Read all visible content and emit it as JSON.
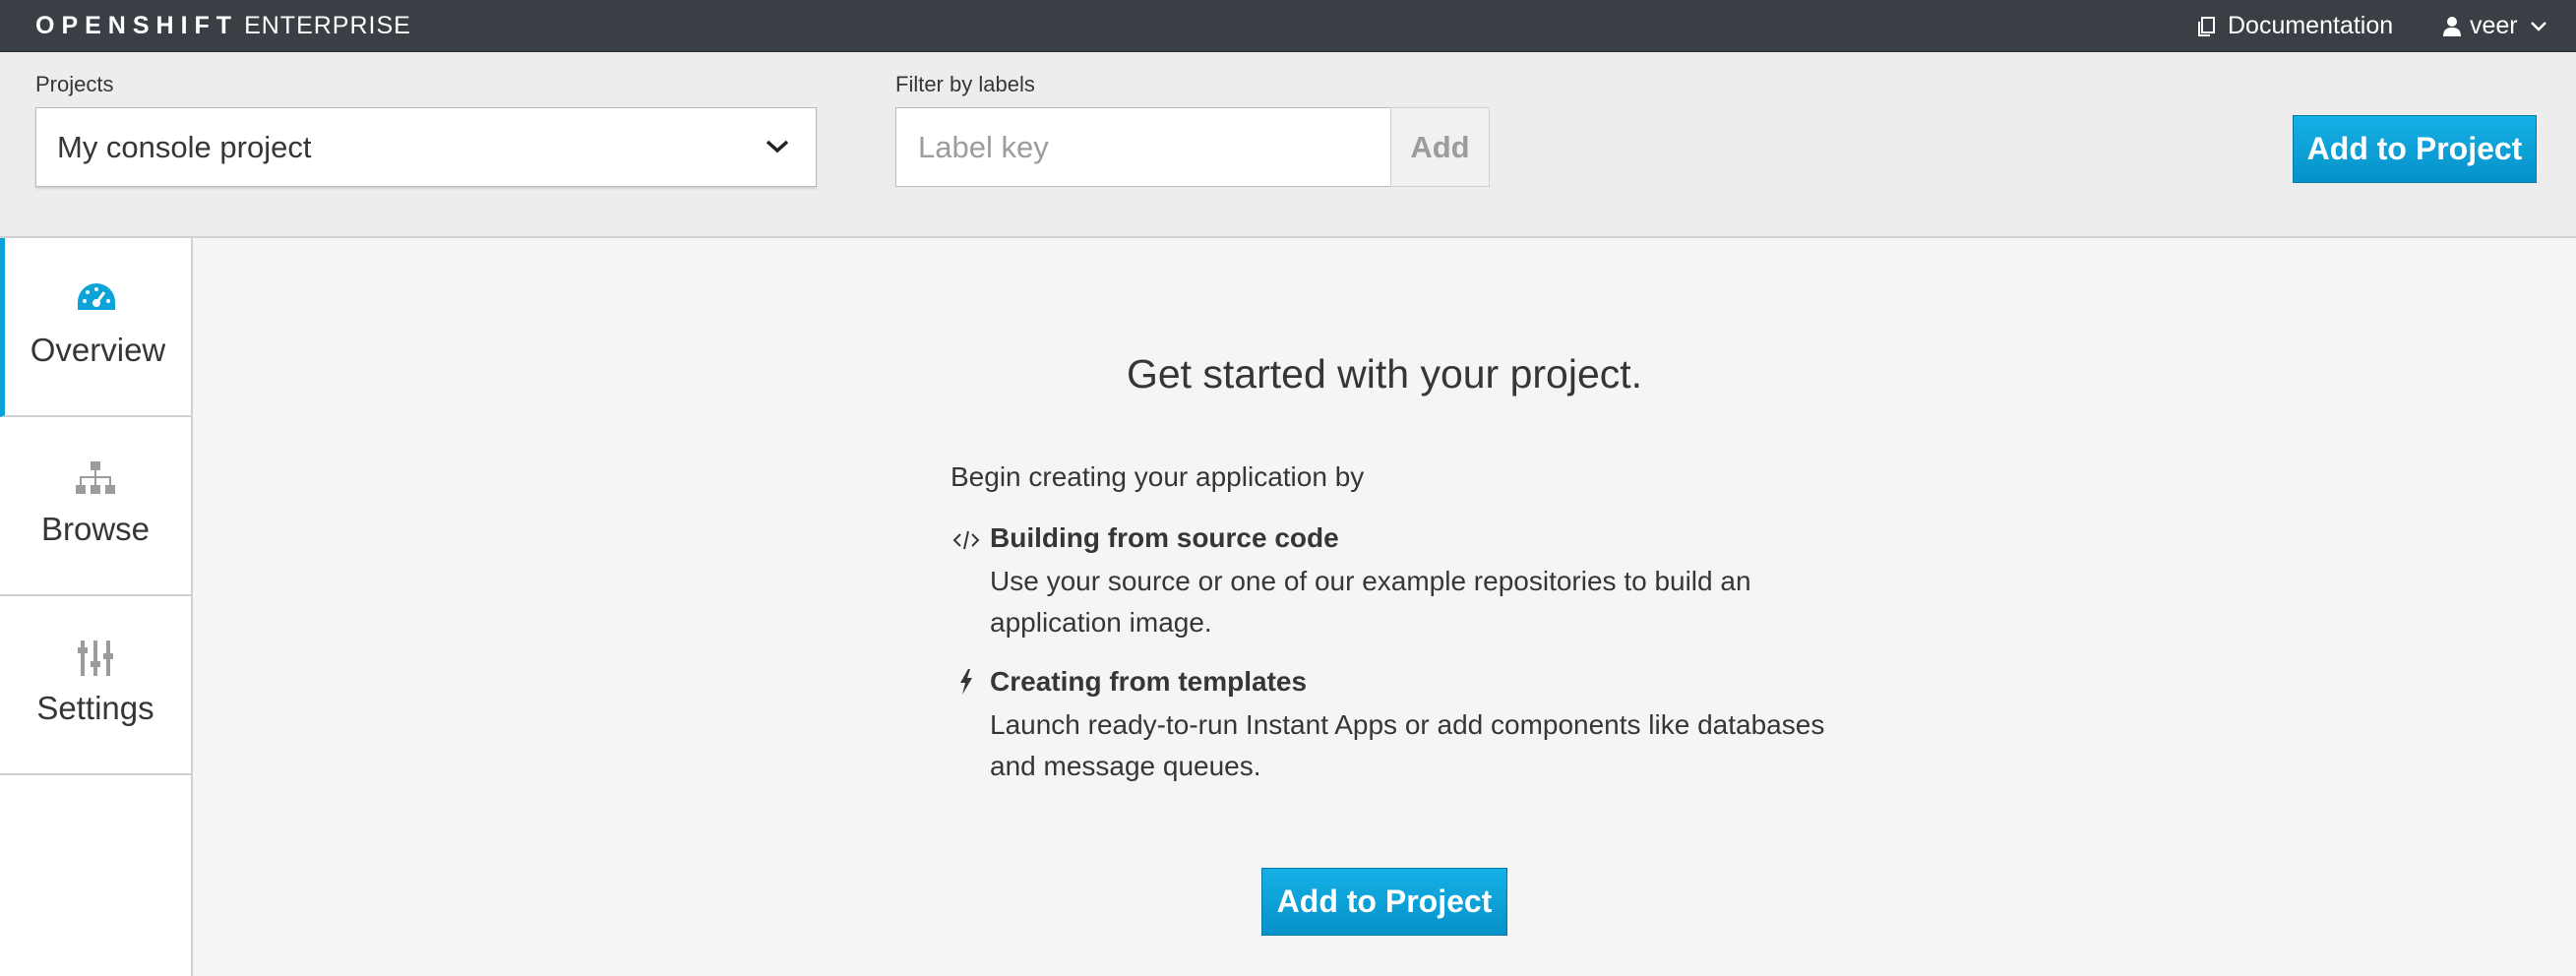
{
  "navbar": {
    "brand_strong": "OPENSHIFT",
    "brand_light": "ENTERPRISE",
    "documentation_label": "Documentation",
    "user_label": "veer"
  },
  "toolbar": {
    "projects_label": "Projects",
    "project_selected": "My console project",
    "filter_label": "Filter by labels",
    "label_key_placeholder": "Label key",
    "add_label": "Add",
    "add_to_project_label": "Add to Project"
  },
  "sidebar": {
    "items": [
      {
        "label": "Overview",
        "icon": "dashboard-icon",
        "active": true
      },
      {
        "label": "Browse",
        "icon": "sitemap-icon",
        "active": false
      },
      {
        "label": "Settings",
        "icon": "sliders-icon",
        "active": false
      }
    ]
  },
  "main": {
    "headline": "Get started with your project.",
    "intro": "Begin creating your application by",
    "options": [
      {
        "icon": "code-icon",
        "title": "Building from source code",
        "description": "Use your source or one of our example repositories to build an application image."
      },
      {
        "icon": "bolt-icon",
        "title": "Creating from templates",
        "description": "Launch ready-to-run Instant Apps or add components like databases and message queues."
      }
    ],
    "add_to_project_label": "Add to Project"
  },
  "colors": {
    "navbar_bg": "#393f44",
    "toolbar_bg": "#ededed",
    "primary": "#0ca3d8",
    "active_accent": "#0ca3d8"
  }
}
